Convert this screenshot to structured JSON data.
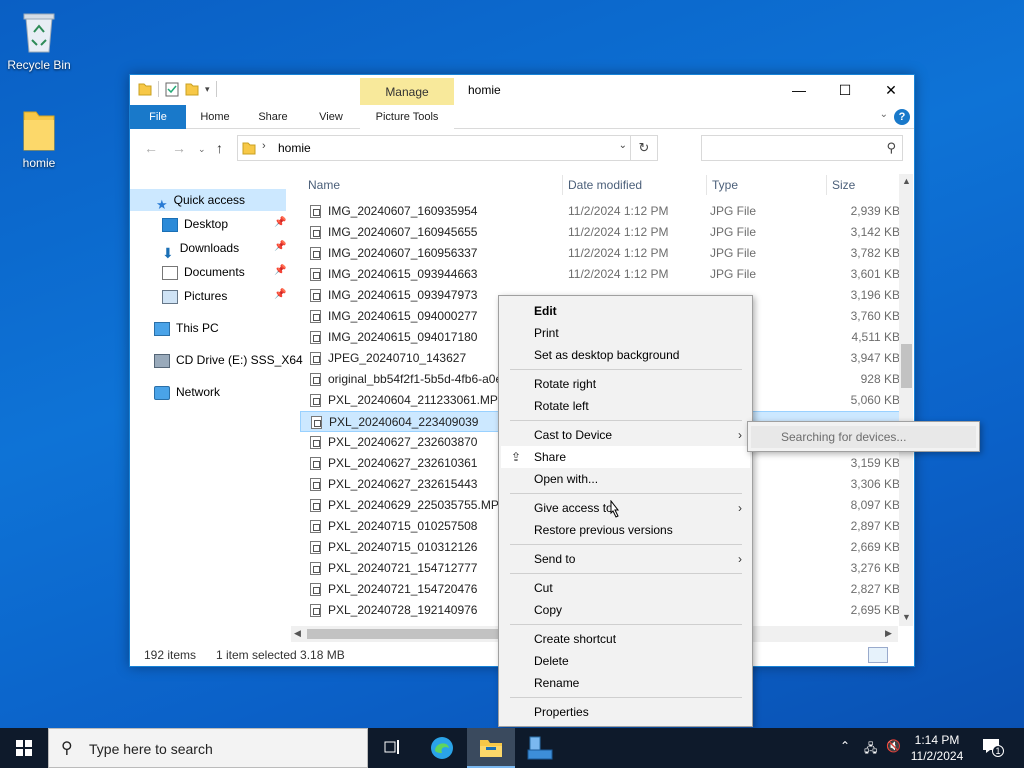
{
  "desktop": {
    "icons": [
      {
        "label": "Recycle Bin",
        "icon": "recycle-bin-icon"
      },
      {
        "label": "homie",
        "icon": "folder-icon"
      }
    ]
  },
  "window": {
    "title": "homie",
    "manage_tab": "Manage",
    "ribbon_tabs": [
      "File",
      "Home",
      "Share",
      "View",
      "Picture Tools"
    ],
    "address": {
      "path": "homie"
    },
    "search": {
      "placeholder": ""
    },
    "nav": {
      "quick_access": "Quick access",
      "items": [
        "Desktop",
        "Downloads",
        "Documents",
        "Pictures"
      ],
      "this_pc": "This PC",
      "cd_drive": "CD Drive (E:) SSS_X64",
      "network": "Network"
    },
    "columns": {
      "name": "Name",
      "date": "Date modified",
      "type": "Type",
      "size": "Size"
    },
    "files": [
      {
        "name": "IMG_20240607_160935954",
        "date": "11/2/2024 1:12 PM",
        "type": "JPG File",
        "size": "2,939 KB"
      },
      {
        "name": "IMG_20240607_160945655",
        "date": "11/2/2024 1:12 PM",
        "type": "JPG File",
        "size": "3,142 KB"
      },
      {
        "name": "IMG_20240607_160956337",
        "date": "11/2/2024 1:12 PM",
        "type": "JPG File",
        "size": "3,782 KB"
      },
      {
        "name": "IMG_20240615_093944663",
        "date": "11/2/2024 1:12 PM",
        "type": "JPG File",
        "size": "3,601 KB"
      },
      {
        "name": "IMG_20240615_093947973",
        "date": "",
        "type": "",
        "size": "3,196 KB"
      },
      {
        "name": "IMG_20240615_094000277",
        "date": "",
        "type": "",
        "size": "3,760 KB"
      },
      {
        "name": "IMG_20240615_094017180",
        "date": "",
        "type": "",
        "size": "4,511 KB"
      },
      {
        "name": "JPEG_20240710_143627",
        "date": "",
        "type": "",
        "size": "3,947 KB"
      },
      {
        "name": "original_bb54f2f1-5b5d-4fb6-a0e",
        "date": "",
        "type": "",
        "size": "928 KB"
      },
      {
        "name": "PXL_20240604_211233061.MP",
        "date": "",
        "type": "",
        "size": "5,060 KB"
      },
      {
        "name": "PXL_20240604_223409039",
        "date": "",
        "type": "",
        "size": ""
      },
      {
        "name": "PXL_20240627_232603870",
        "date": "",
        "type": "",
        "size": ""
      },
      {
        "name": "PXL_20240627_232610361",
        "date": "",
        "type": "",
        "size": "3,159 KB"
      },
      {
        "name": "PXL_20240627_232615443",
        "date": "",
        "type": "",
        "size": "3,306 KB"
      },
      {
        "name": "PXL_20240629_225035755.MP",
        "date": "",
        "type": "",
        "size": "8,097 KB"
      },
      {
        "name": "PXL_20240715_010257508",
        "date": "",
        "type": "",
        "size": "2,897 KB"
      },
      {
        "name": "PXL_20240715_010312126",
        "date": "",
        "type": "",
        "size": "2,669 KB"
      },
      {
        "name": "PXL_20240721_154712777",
        "date": "",
        "type": "",
        "size": "3,276 KB"
      },
      {
        "name": "PXL_20240721_154720476",
        "date": "",
        "type": "",
        "size": "2,827 KB"
      },
      {
        "name": "PXL_20240728_192140976",
        "date": "",
        "type": "",
        "size": "2,695 KB"
      }
    ],
    "selected_index": 10,
    "status": {
      "count": "192 items",
      "selection": "1 item selected  3.18 MB"
    }
  },
  "context_menu": {
    "items": [
      {
        "label": "Edit",
        "bold": true
      },
      {
        "label": "Print"
      },
      {
        "label": "Set as desktop background"
      },
      {
        "sep": true
      },
      {
        "label": "Rotate right"
      },
      {
        "label": "Rotate left"
      },
      {
        "sep": true
      },
      {
        "label": "Cast to Device",
        "submenu": true
      },
      {
        "label": "Share",
        "icon": "share-icon",
        "highlight": true
      },
      {
        "label": "Open with..."
      },
      {
        "sep": true
      },
      {
        "label": "Give access to",
        "submenu": true
      },
      {
        "label": "Restore previous versions"
      },
      {
        "sep": true
      },
      {
        "label": "Send to",
        "submenu": true
      },
      {
        "sep": true
      },
      {
        "label": "Cut"
      },
      {
        "label": "Copy"
      },
      {
        "sep": true
      },
      {
        "label": "Create shortcut"
      },
      {
        "label": "Delete"
      },
      {
        "label": "Rename"
      },
      {
        "sep": true
      },
      {
        "label": "Properties"
      }
    ],
    "submenu_text": "Searching for devices..."
  },
  "taskbar": {
    "search_placeholder": "Type here to search",
    "time": "1:14 PM",
    "date": "11/2/2024",
    "notification_count": "1"
  },
  "colors": {
    "accent": "#1979ca",
    "selection": "#cce8ff",
    "desktop": "#0e73d6",
    "taskbar": "#0e1a2b"
  }
}
